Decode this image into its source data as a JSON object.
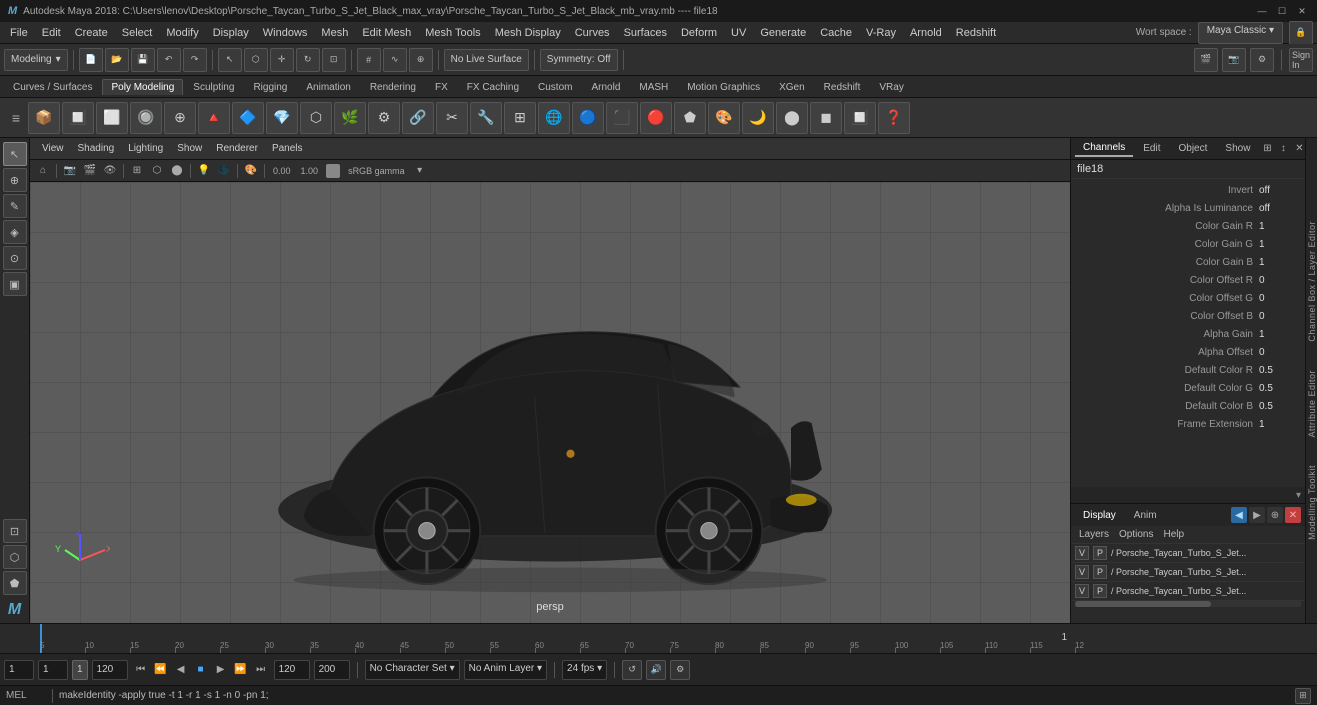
{
  "titleBar": {
    "title": "Autodesk Maya 2018: C:\\Users\\lenov\\Desktop\\Porsche_Taycan_Turbo_S_Jet_Black_max_vray\\Porsche_Taycan_Turbo_S_Jet_Black_mb_vray.mb  ----  file18",
    "winButtons": [
      "—",
      "☐",
      "✕"
    ]
  },
  "menuBar": {
    "items": [
      "File",
      "Edit",
      "Create",
      "Select",
      "Modify",
      "Display",
      "Windows",
      "Mesh",
      "Edit Mesh",
      "Mesh Tools",
      "Mesh Display",
      "Curves",
      "Surfaces",
      "Deform",
      "UV",
      "Generate",
      "Cache",
      "V-Ray",
      "Arnold",
      "Redshift"
    ],
    "workspace_label": "Wort space :",
    "workspace_value": "Maya Classic"
  },
  "toolbar": {
    "mode_dropdown": "Modeling",
    "symmetry": "Symmetry: Off",
    "no_live": "No Live Surface",
    "sign_in": "Sign In"
  },
  "shelfTabs": {
    "tabs": [
      "Curves / Surfaces",
      "Poly Modeling",
      "Sculpting",
      "Rigging",
      "Animation",
      "Rendering",
      "FX",
      "FX Caching",
      "Custom",
      "Arnold",
      "MASH",
      "Motion Graphics",
      "XGen",
      "Redshift",
      "VRay"
    ],
    "active": "Poly Modeling"
  },
  "viewport": {
    "menuItems": [
      "View",
      "Shading",
      "Lighting",
      "Show",
      "Renderer",
      "Panels"
    ],
    "perspLabel": "persp",
    "colorSpace": "sRGB gamma",
    "zeroVal": "0.00",
    "oneVal": "1.00"
  },
  "rightPanel": {
    "tabs": [
      "Channels",
      "Edit",
      "Object",
      "Show"
    ],
    "title": "file18",
    "properties": [
      {
        "label": "Invert",
        "value": "off"
      },
      {
        "label": "Alpha Is Luminance",
        "value": "off"
      },
      {
        "label": "Color Gain R",
        "value": "1"
      },
      {
        "label": "Color Gain G",
        "value": "1"
      },
      {
        "label": "Color Gain B",
        "value": "1"
      },
      {
        "label": "Color Offset R",
        "value": "0"
      },
      {
        "label": "Color Offset G",
        "value": "0"
      },
      {
        "label": "Color Offset B",
        "value": "0"
      },
      {
        "label": "Alpha Gain",
        "value": "1"
      },
      {
        "label": "Alpha Offset",
        "value": "0"
      },
      {
        "label": "Default Color R",
        "value": "0.5"
      },
      {
        "label": "Default Color G",
        "value": "0.5"
      },
      {
        "label": "Default Color B",
        "value": "0.5"
      },
      {
        "label": "Frame Extension",
        "value": "1"
      }
    ]
  },
  "layersPanel": {
    "tabs": [
      "Display",
      "Anim"
    ],
    "menuItems": [
      "Layers",
      "Options",
      "Help"
    ],
    "layers": [
      {
        "name": "Porsche_Taycan_Turbo_S_Jet...",
        "v": "V",
        "p": "P"
      },
      {
        "name": "Porsche_Taycan_Turbo_S_Jet...",
        "v": "V",
        "p": "P"
      },
      {
        "name": "Porsche_Taycan_Turbo_S_Jet...",
        "v": "V",
        "p": "P"
      }
    ]
  },
  "timeline": {
    "ticks": [
      "5",
      "10",
      "15",
      "20",
      "25",
      "30",
      "35",
      "40",
      "45",
      "50",
      "55",
      "60",
      "65",
      "70",
      "75",
      "80",
      "85",
      "90",
      "95",
      "100",
      "105",
      "110",
      "115",
      "12"
    ],
    "currentFrame": "1",
    "endFrame": "120",
    "rangeEnd": "200",
    "rangeStart": "120"
  },
  "bottomControls": {
    "frame1": "1",
    "frame2": "1",
    "frame3": "1",
    "rangeStart": "120",
    "rangeEnd": "120",
    "rangeEnd2": "200",
    "noCharSet": "No Character Set",
    "noAnimLayer": "No Anim Layer",
    "fps": "24 fps"
  },
  "statusBar": {
    "lang": "MEL",
    "command": "makeIdentity -apply true -t 1 -r 1 -s 1 -n 0 -pn 1;"
  },
  "leftToolbar": {
    "tools": [
      "↖",
      "⊕",
      "✎",
      "◈",
      "⊙",
      "▣",
      "⊡",
      "⬡",
      "⬟"
    ]
  },
  "icons": {
    "search": "🔍",
    "gear": "⚙",
    "close": "✕",
    "chevron_down": "▾",
    "play": "▶",
    "play_back": "◀",
    "skip_end": "⏭",
    "skip_start": "⏮",
    "step_fwd": "⏩",
    "step_back": "⏪",
    "loop": "↺"
  },
  "sideLabels": [
    "Channel Box / Layer Editor",
    "Attribute Editor",
    "Modelling Toolkit"
  ]
}
